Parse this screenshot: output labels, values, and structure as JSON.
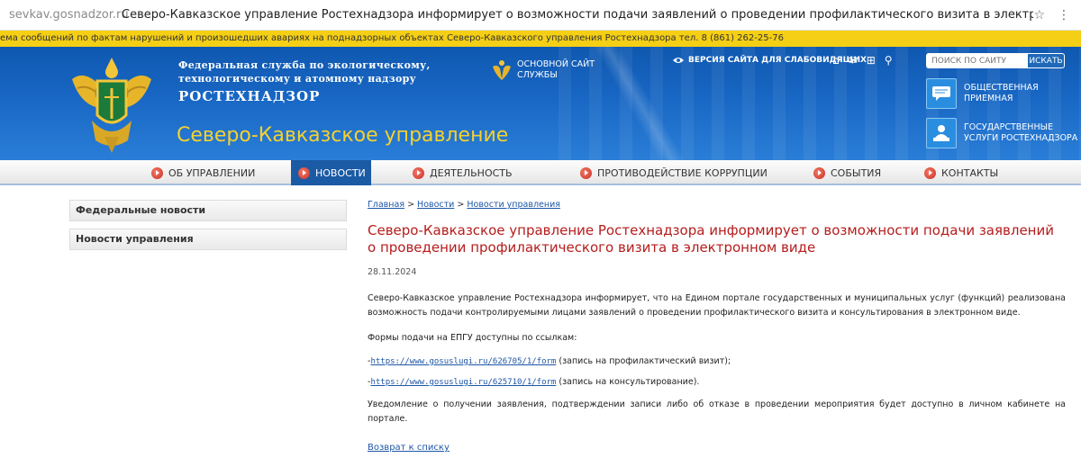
{
  "browser": {
    "url": "sevkav.gosnadzor.ru",
    "tab_title": "Северо-Кавказское управление Ростехнадзора информирует о возможности подачи заявлений о проведении профилактического визита в электронном виде"
  },
  "ticker": "ема сообщений по фактам нарушений и произошедших авариях на поднадзорных объектах Северо-Кавказского управления Ростехнадзора тел. 8 (861) 262-25-76",
  "header": {
    "agency_line1": "Федеральная служба по экологическому,",
    "agency_line2": "технологическому и атомному надзору",
    "agency_short": "РОСТЕХНАДЗОР",
    "region": "Северо-Кавказское управление",
    "main_site_line1": "ОСНОВНОЙ САЙТ",
    "main_site_line2": "СЛУЖБЫ",
    "accessibility": "ВЕРСИЯ САЙТА ДЛЯ СЛАБОВИДЯЩИХ",
    "search_placeholder": "ПОИСК ПО САЙТУ",
    "search_button": "ИСКАТЬ",
    "public_reception_line1": "ОБЩЕСТВЕННАЯ",
    "public_reception_line2": "ПРИЕМНАЯ",
    "services_line1": "ГОСУДАРСТВЕННЫЕ",
    "services_line2": "УСЛУГИ РОСТЕХНАДЗОРА"
  },
  "nav": {
    "about": "ОБ УПРАВЛЕНИИ",
    "news": "НОВОСТИ",
    "activity": "ДЕЯТЕЛЬНОСТЬ",
    "anticorruption": "ПРОТИВОДЕЙСТВИЕ КОРРУПЦИИ",
    "events": "СОБЫТИЯ",
    "contacts": "КОНТАКТЫ"
  },
  "sidebar": {
    "items": [
      {
        "label": "Федеральные новости"
      },
      {
        "label": "Новости управления"
      }
    ]
  },
  "article": {
    "breadcrumb": {
      "home": "Главная",
      "sep1": " > ",
      "news": "Новости",
      "sep2": " > ",
      "section": "Новости управления"
    },
    "title": "Северо-Кавказское управление Ростехнадзора информирует о возможности подачи заявлений о проведении профилактического визита в электронном виде",
    "date": "28.11.2024",
    "intro": "Северо-Кавказское управление Ростехнадзора информирует, что на Едином портале государственных и муниципальных услуг (функций) реализована возможность подачи контролируемыми лицами заявлений о проведении профилактического визита и консультирования в электронном виде.",
    "forms_heading": "Формы подачи на ЕПГУ доступны по ссылкам:",
    "link1_prefix": "-",
    "link1_url": "https://www.gosuslugi.ru/626705/1/form",
    "link1_note": " (запись на профилактический визит);",
    "link2_prefix": "-",
    "link2_url": "https://www.gosuslugi.ru/625710/1/form",
    "link2_note": " (запись на консультирование).",
    "notice": "Уведомление о получении заявления, подтверждении записи либо об отказе в проведении мероприятия будет доступно в личном кабинете на портале.",
    "back_link": "Возврат к списку"
  }
}
